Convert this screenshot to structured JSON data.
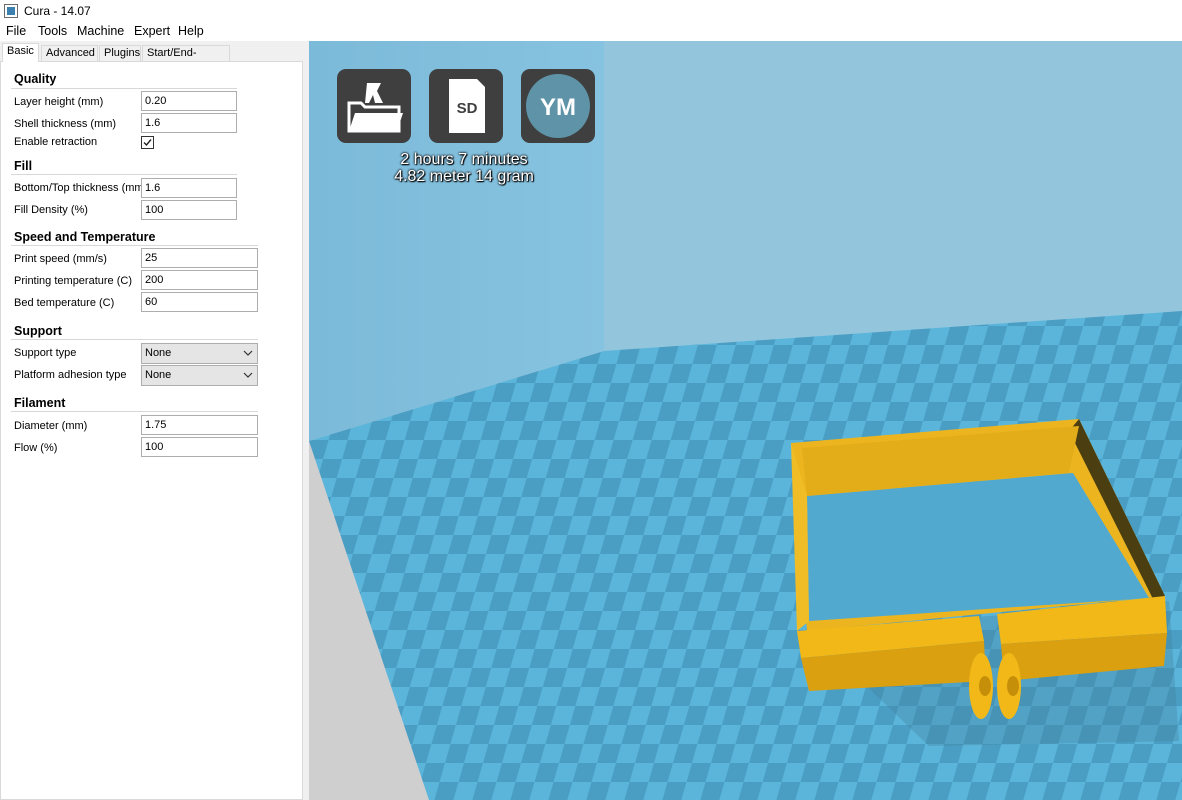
{
  "window": {
    "title": "Cura - 14.07"
  },
  "menu": {
    "items": [
      "File",
      "Tools",
      "Machine",
      "Expert",
      "Help"
    ]
  },
  "tabs": [
    "Basic",
    "Advanced",
    "Plugins",
    "Start/End-GCode"
  ],
  "sections": {
    "quality": {
      "title": "Quality",
      "layer_height_label": "Layer height (mm)",
      "layer_height_value": "0.20",
      "shell_thickness_label": "Shell thickness (mm)",
      "shell_thickness_value": "1.6",
      "enable_retraction_label": "Enable retraction",
      "enable_retraction_checked": true
    },
    "fill": {
      "title": "Fill",
      "bottom_top_label": "Bottom/Top thickness (mm)",
      "bottom_top_value": "1.6",
      "fill_density_label": "Fill Density (%)",
      "fill_density_value": "100"
    },
    "speed": {
      "title": "Speed and Temperature",
      "print_speed_label": "Print speed (mm/s)",
      "print_speed_value": "25",
      "print_temp_label": "Printing temperature (C)",
      "print_temp_value": "200",
      "bed_temp_label": "Bed temperature (C)",
      "bed_temp_value": "60"
    },
    "support": {
      "title": "Support",
      "support_type_label": "Support type",
      "support_type_value": "None",
      "adhesion_label": "Platform adhesion type",
      "adhesion_value": "None"
    },
    "filament": {
      "title": "Filament",
      "diameter_label": "Diameter (mm)",
      "diameter_value": "1.75",
      "flow_label": "Flow (%)",
      "flow_value": "100"
    }
  },
  "viewport": {
    "buttons": [
      {
        "icon": "load-model-icon"
      },
      {
        "icon": "sd-card-icon",
        "label": "SD"
      },
      {
        "icon": "youmagine-icon",
        "label": "YM"
      }
    ],
    "print_time": "2 hours 7 minutes",
    "print_material": "4.82 meter 14 gram",
    "model_color": "#ecb520",
    "platform_color": "#5bb5da"
  }
}
